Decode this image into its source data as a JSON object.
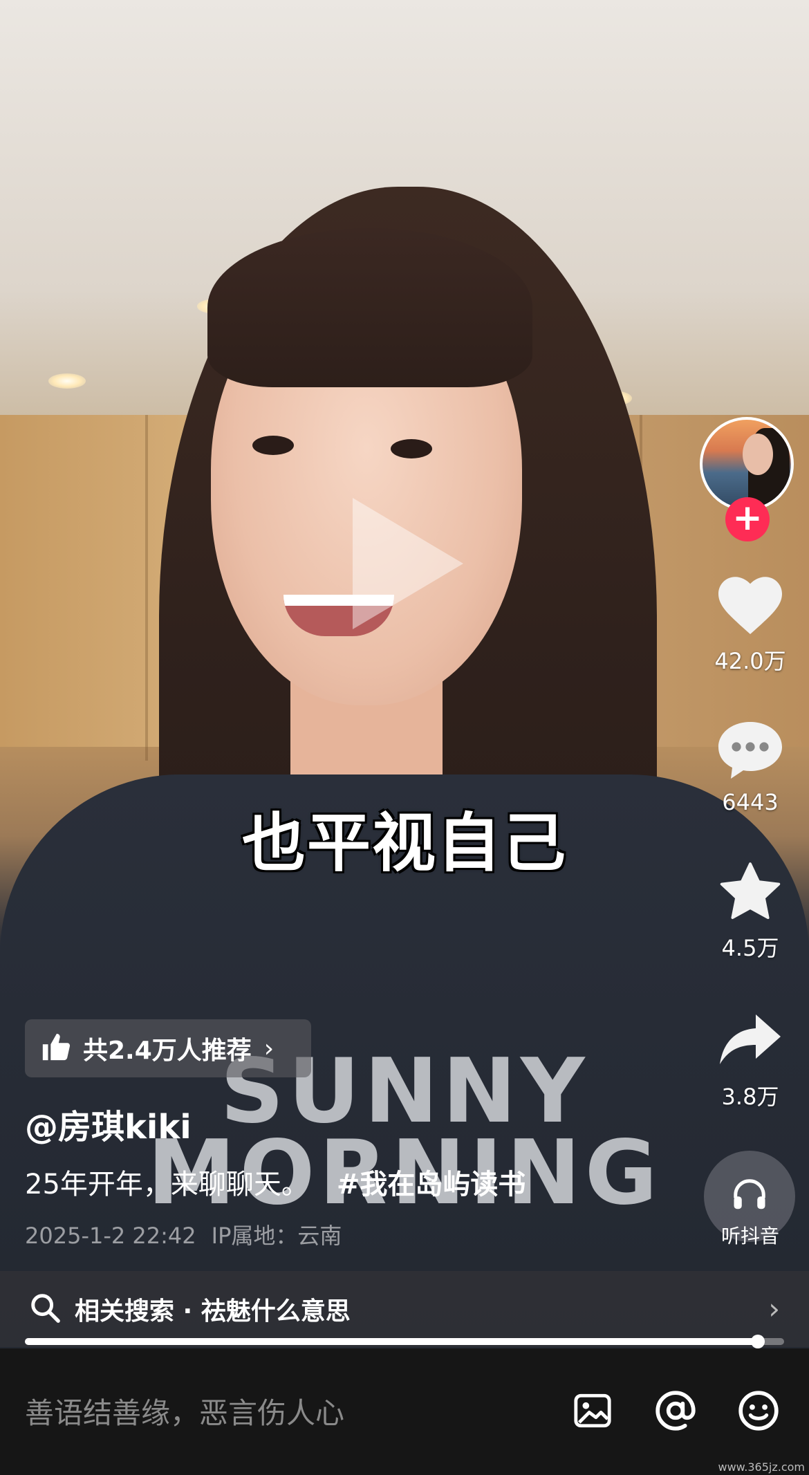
{
  "video": {
    "subtitle": "也平视自己",
    "shirt_line1": "SUNNY",
    "shirt_line2": "MORNING"
  },
  "actions": {
    "likes": "42.0万",
    "comments": "6443",
    "favorites": "4.5万",
    "shares": "3.8万",
    "listen_label": "听抖音",
    "follow_symbol": "+"
  },
  "info": {
    "recommend_text": "共2.4万人推荐",
    "recommend_arrow": "›",
    "author": "@房琪kiki",
    "caption": "25年开年，来聊聊天。",
    "hashtag": "#我在岛屿读书",
    "date": "2025-1-2 22:42",
    "ip_location": "IP属地：云南"
  },
  "related_search": {
    "text": "相关搜索 · 祛魅什么意思",
    "chevron": "›"
  },
  "progress": {
    "fraction": 0.965
  },
  "comment_bar": {
    "placeholder": "善语结善缘，恶言伤人心"
  },
  "watermark": "www.365jz.com",
  "icons": {
    "like": "heart-icon",
    "comment": "comment-icon",
    "favorite": "star-icon",
    "share": "share-icon",
    "listen": "headphones-icon",
    "recommend": "thumbs-up-icon",
    "search": "search-icon",
    "image": "image-icon",
    "mention": "at-icon",
    "emoji": "emoji-icon"
  },
  "colors": {
    "follow_button": "#fe2c55",
    "background": "#161616"
  }
}
